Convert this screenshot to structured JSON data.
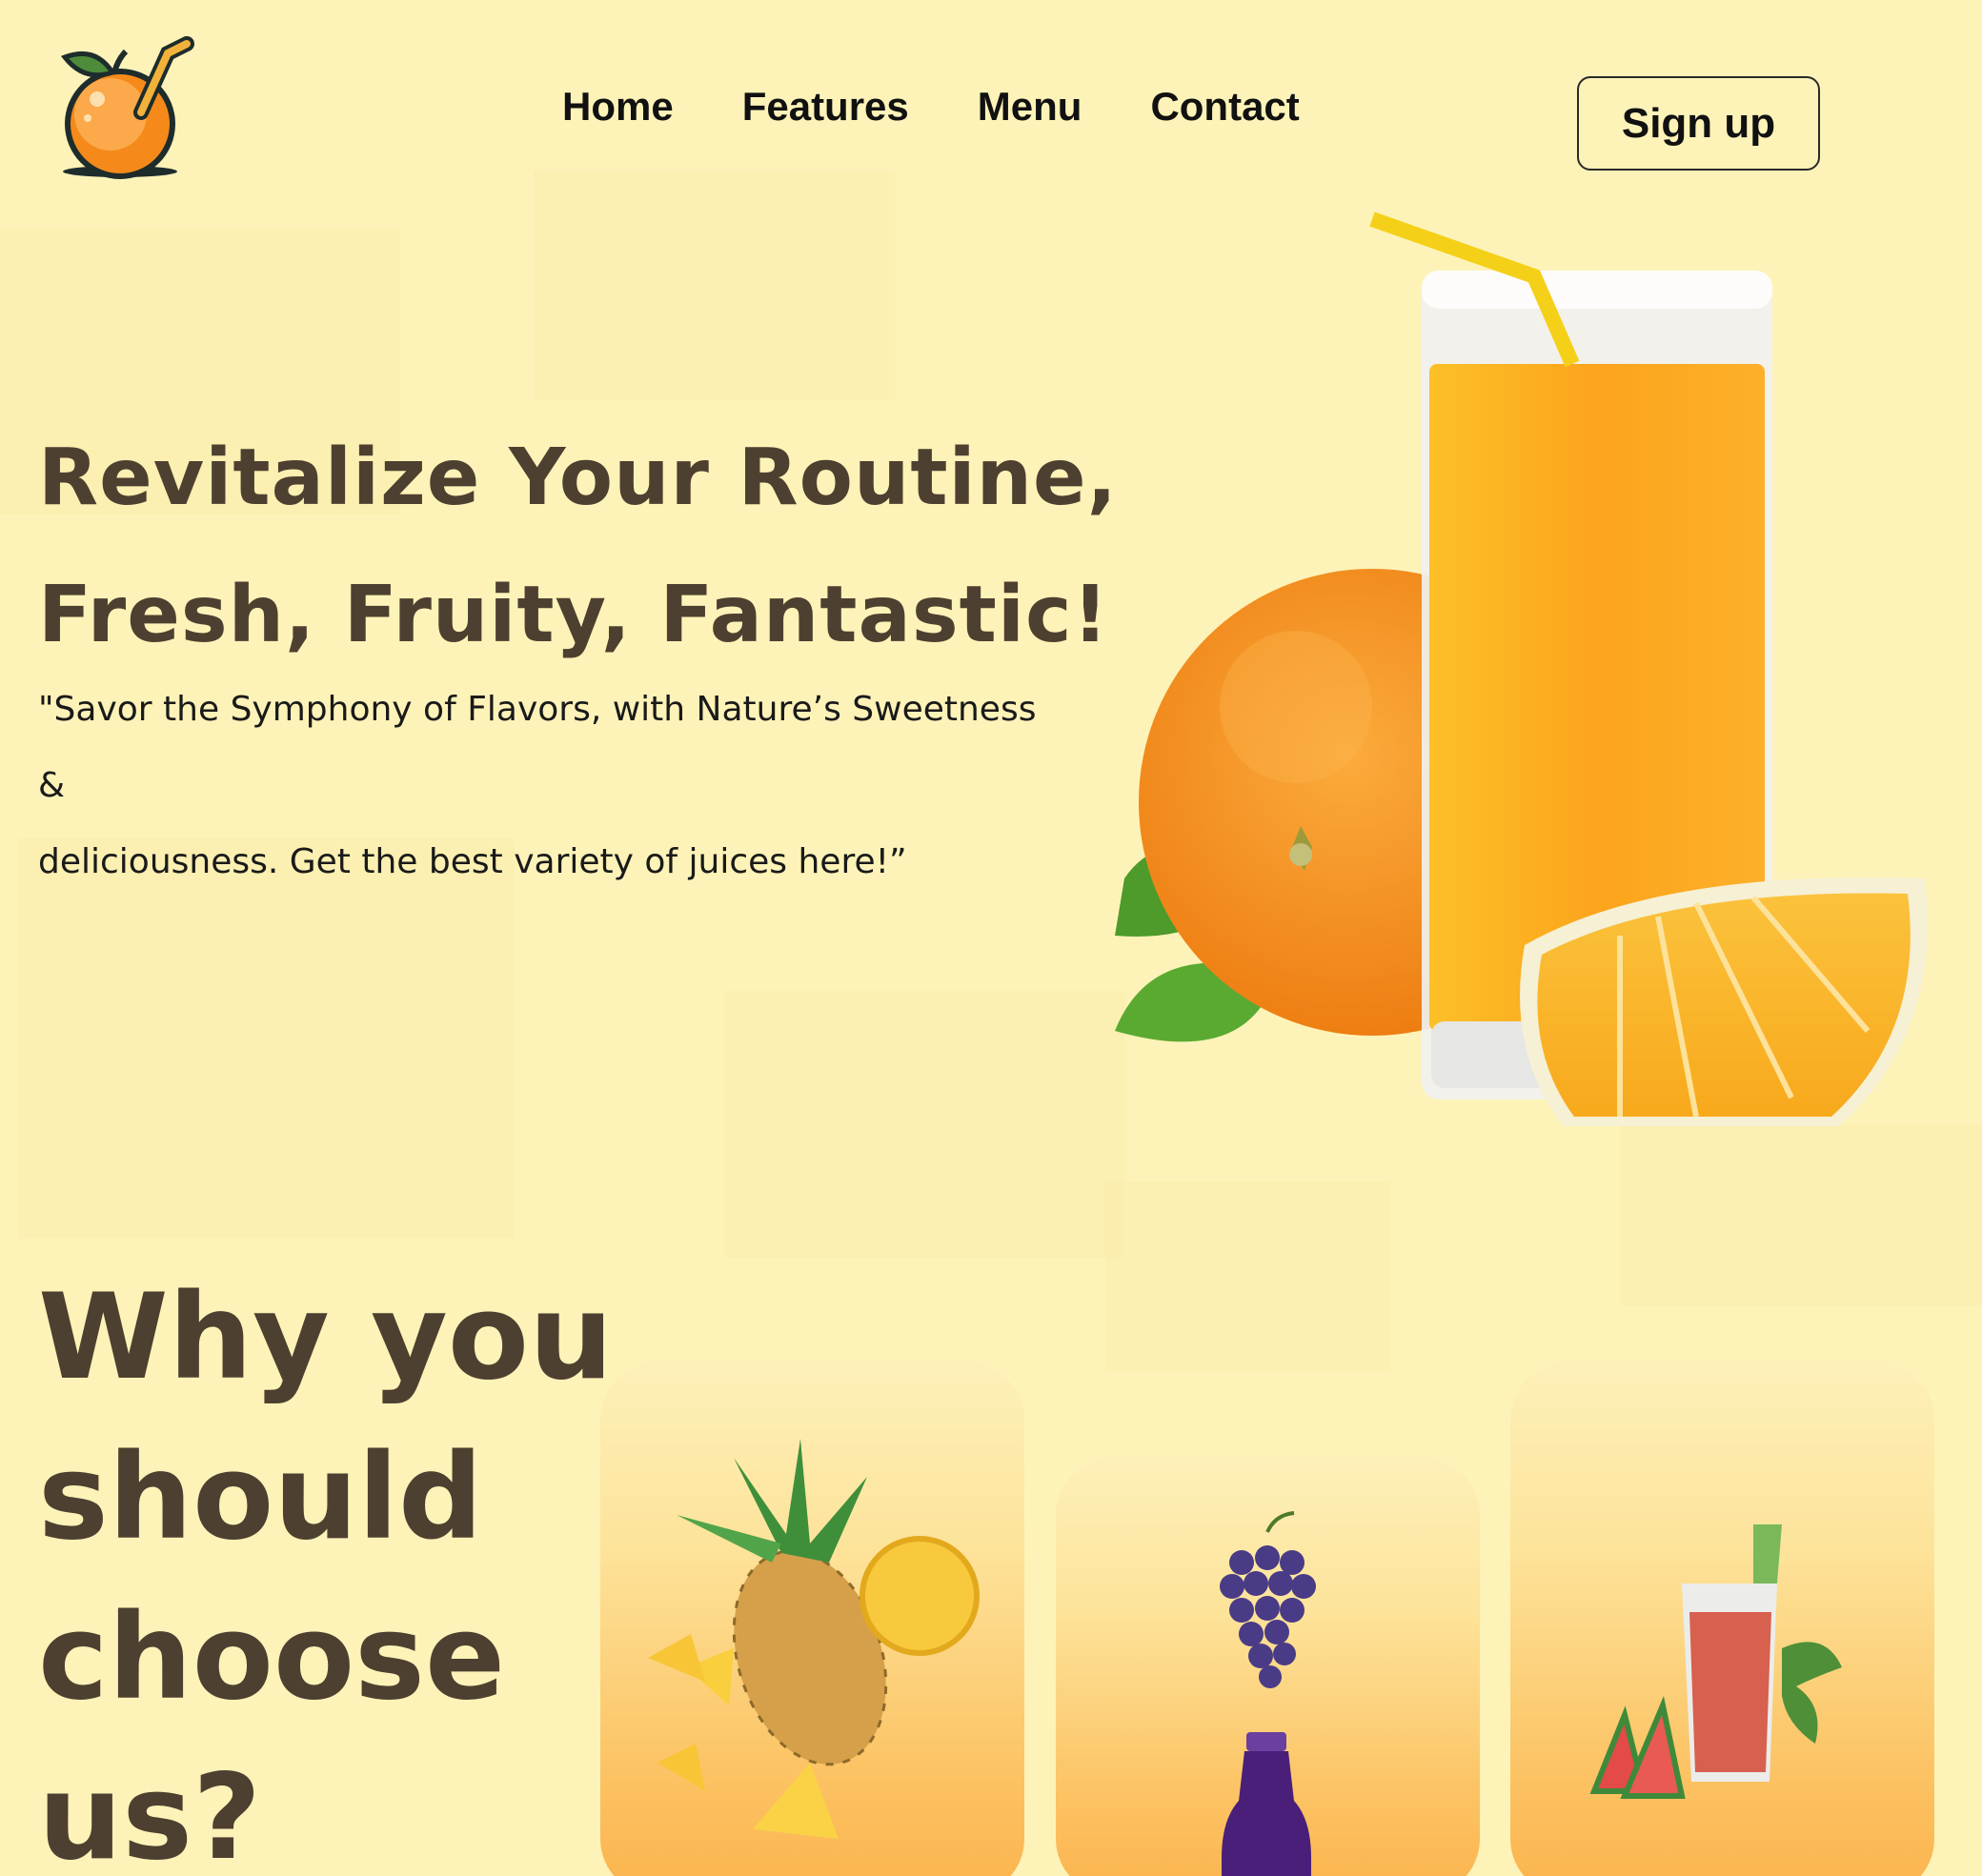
{
  "nav": {
    "items": [
      {
        "label": "Home"
      },
      {
        "label": "Features"
      },
      {
        "label": "Menu"
      },
      {
        "label": "Contact"
      }
    ],
    "signup_label": "Sign up"
  },
  "hero": {
    "title_line1": "Revitalize Your Routine,",
    "title_line2": "Fresh, Fruity, Fantastic!",
    "subtitle_line1": "\"Savor the Symphony of Flavors, with Nature’s Sweetness &",
    "subtitle_line2": "deliciousness. Get the best variety of juices here!”"
  },
  "why": {
    "line1": "Why you",
    "line2": "should",
    "line3": "choose",
    "line4": "us?"
  },
  "cards": [
    {
      "icon": "pineapple-icon"
    },
    {
      "icon": "grape-juice-icon"
    },
    {
      "icon": "watermelon-juice-icon"
    }
  ],
  "colors": {
    "background": "#fdf3b8",
    "heading": "#4e4030",
    "accent_orange": "#fba71e",
    "card_bottom": "#fbb44d"
  }
}
